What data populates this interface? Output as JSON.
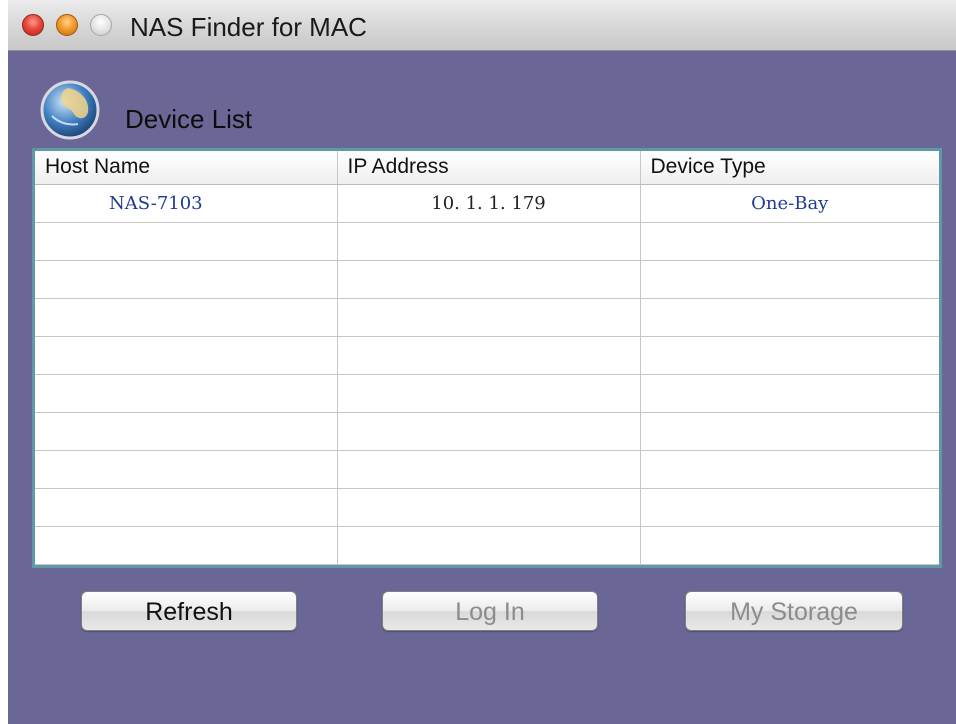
{
  "window": {
    "title": "NAS Finder for MAC"
  },
  "section": {
    "label": "Device List",
    "icon": "globe-icon"
  },
  "table": {
    "columns": [
      "Host Name",
      "IP Address",
      "Device Type"
    ],
    "rows": [
      {
        "host": "NAS-7103",
        "ip": "10. 1. 1. 179",
        "type": "One-Bay"
      }
    ],
    "empty_row_count": 9
  },
  "buttons": {
    "refresh": "Refresh",
    "login": "Log In",
    "my_storage": "My Storage"
  },
  "colors": {
    "window_background": "#6a6696",
    "table_border": "#5e9aa5",
    "row_text": "#1f3a93"
  }
}
